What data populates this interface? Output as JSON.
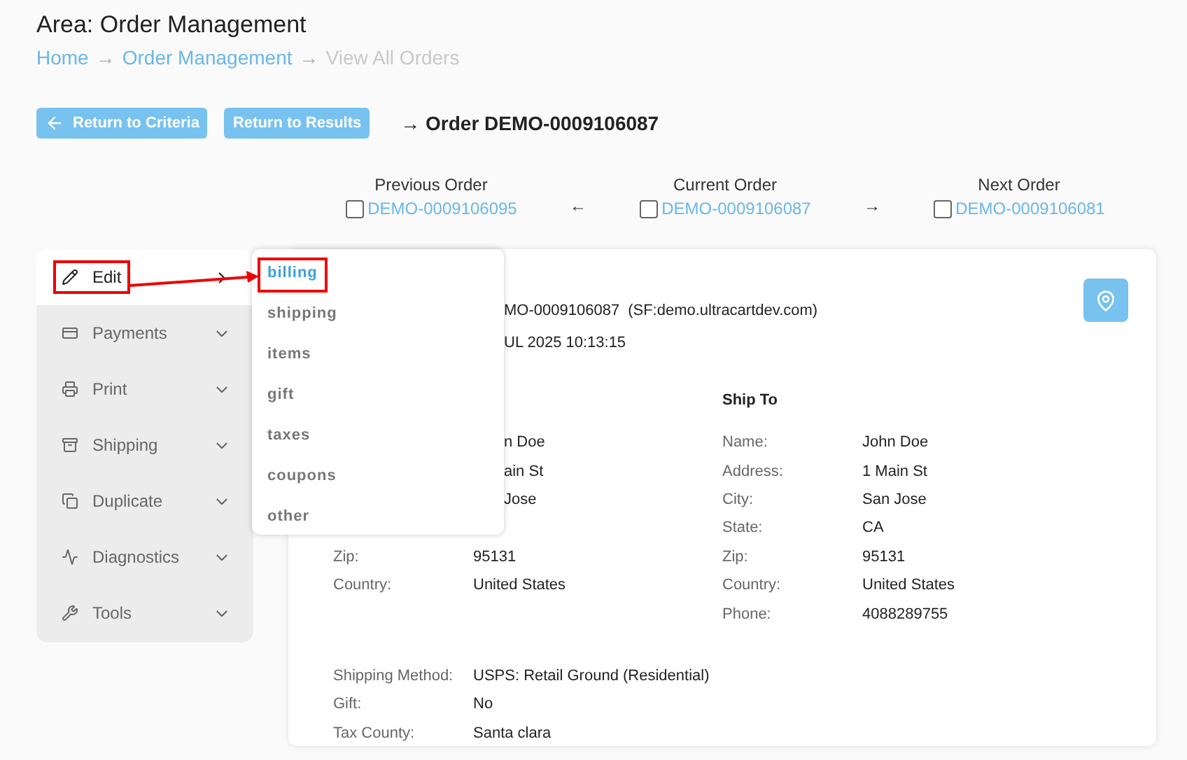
{
  "header": {
    "title": "Area: Order Management",
    "breadcrumb": [
      {
        "label": "Home",
        "link": true
      },
      {
        "label": "Order Management",
        "link": true
      },
      {
        "label": "View All Orders",
        "link": false
      }
    ],
    "separator": "→"
  },
  "actions": {
    "buttons": [
      {
        "label": "Return to Criteria"
      },
      {
        "label": "Return to Results"
      }
    ],
    "heading_arrow": "→",
    "heading": "Order DEMO-0009106087"
  },
  "order_nav": [
    {
      "label": "Previous Order",
      "order": "DEMO-0009106095",
      "checked": false
    },
    {
      "label": "Current Order",
      "order": "DEMO-0009106087",
      "checked": false
    },
    {
      "label": "Next Order",
      "order": "DEMO-0009106081",
      "checked": false
    }
  ],
  "nav_arrows": [
    "←",
    "→"
  ],
  "sidebar": {
    "items": [
      {
        "label": "Edit",
        "selected": true
      },
      {
        "label": "Payments",
        "selected": false
      },
      {
        "label": "Print",
        "selected": false
      },
      {
        "label": "Shipping",
        "selected": false
      },
      {
        "label": "Duplicate",
        "selected": false
      },
      {
        "label": "Diagnostics",
        "selected": false
      },
      {
        "label": "Tools",
        "selected": false
      }
    ]
  },
  "edit_menu": {
    "items": [
      {
        "label": "billing",
        "selected": true
      },
      {
        "label": "shipping",
        "selected": false
      },
      {
        "label": "items",
        "selected": false
      },
      {
        "label": "gift",
        "selected": false
      },
      {
        "label": "taxes",
        "selected": false
      },
      {
        "label": "coupons",
        "selected": false
      },
      {
        "label": "other",
        "selected": false
      }
    ]
  },
  "order": {
    "summary": [
      {
        "value": "MO-0009106087",
        "note": "(SF:demo.ultracartdev.com)"
      },
      {
        "value": "UL 2025 10:13:15"
      }
    ],
    "bill_to": {
      "rows": [
        {
          "kind": "partial",
          "value": "n Doe"
        },
        {
          "kind": "partial",
          "value": "ain St"
        },
        {
          "kind": "partial",
          "value": "Jose"
        },
        {
          "kind": "covered"
        },
        {
          "kind": "full",
          "label": "Zip:",
          "value": "95131"
        },
        {
          "kind": "full",
          "label": "Country:",
          "value": "United States"
        }
      ]
    },
    "ship_to": {
      "title": "Ship To",
      "rows": [
        {
          "label": "Name:",
          "value": "John Doe"
        },
        {
          "label": "Address:",
          "value": "1 Main St"
        },
        {
          "label": "City:",
          "value": "San Jose"
        },
        {
          "label": "State:",
          "value": "CA"
        },
        {
          "label": "Zip:",
          "value": "95131"
        },
        {
          "label": "Country:",
          "value": "United States"
        },
        {
          "label": "Phone:",
          "value": "4088289755"
        }
      ]
    },
    "details": [
      {
        "label": "Shipping Method:",
        "value": "USPS: Retail Ground (Residential)"
      },
      {
        "label": "Gift:",
        "value": "No"
      },
      {
        "label": "Tax County:",
        "value": "Santa clara"
      }
    ]
  }
}
